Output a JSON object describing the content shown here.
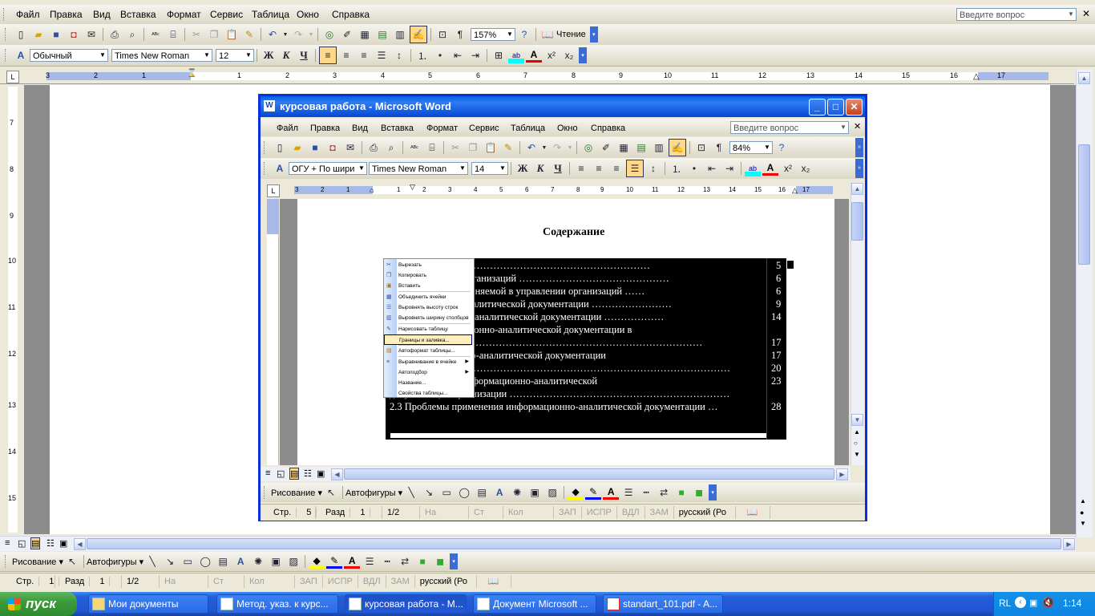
{
  "outer": {
    "menu": [
      "Файл",
      "Правка",
      "Вид",
      "Вставка",
      "Формат",
      "Сервис",
      "Таблица",
      "Окно",
      "Справка"
    ],
    "ask_placeholder": "Введите вопрос",
    "zoom": "157%",
    "read_label": "Чтение",
    "style": "Обычный",
    "font": "Times New Roman",
    "size": "12",
    "drawing_label": "Рисование",
    "autoshapes_label": "Автофигуры",
    "ruler_ticks": [
      "3",
      "2",
      "1",
      "1",
      "2",
      "3",
      "4",
      "5",
      "6",
      "7",
      "8",
      "9",
      "10",
      "11",
      "12",
      "13",
      "14",
      "15",
      "16",
      "17"
    ],
    "vruler_ticks": [
      "7",
      "8",
      "9",
      "10",
      "11",
      "12",
      "13",
      "14",
      "15"
    ],
    "status": {
      "page": "Стр.",
      "page_num": "1",
      "section": "Разд",
      "section_num": "1",
      "pages": "1/2",
      "at": "На",
      "line": "Ст",
      "col": "Кол",
      "rec": "ЗАП",
      "trk": "ИСПР",
      "ext": "ВДЛ",
      "ovr": "ЗАМ",
      "lang": "русский (Ро"
    }
  },
  "inner": {
    "title": "курсовая работа - Microsoft Word",
    "menu": [
      "Файл",
      "Правка",
      "Вид",
      "Вставка",
      "Формат",
      "Сервис",
      "Таблица",
      "Окно",
      "Справка"
    ],
    "ask_placeholder": "Введите вопрос",
    "zoom": "84%",
    "style": "ОГУ + По шири",
    "font": "Times New Roman",
    "size": "14",
    "drawing_label": "Рисование",
    "autoshapes_label": "Автофигуры",
    "ruler_ticks": [
      "3",
      "2",
      "1",
      "1",
      "2",
      "3",
      "4",
      "5",
      "6",
      "7",
      "8",
      "9",
      "10",
      "11",
      "12",
      "13",
      "14",
      "15",
      "16",
      "17"
    ],
    "status": {
      "page": "Стр.",
      "page_num": "5",
      "section": "Разд",
      "section_num": "1",
      "pages": "1/2",
      "at": "На",
      "line": "Ст",
      "col": "Кол",
      "rec": "ЗАП",
      "trk": "ИСПР",
      "ext": "ВДЛ",
      "ovr": "ЗАМ",
      "lang": "русский (Ро"
    }
  },
  "document": {
    "heading": "Содержание",
    "toc": [
      {
        "text": "……………………………………………………………………",
        "page": "5"
      },
      {
        "text": "ии в управлении организаций ………………………………………",
        "page": "6"
      },
      {
        "text": "информации, применяемой в управлении организаций ……",
        "page": "6"
      },
      {
        "text": "информационно-аналитической документации ……………………",
        "page": "9"
      },
      {
        "text": "ия информационно-аналитической документации ………………",
        "page": "14"
      },
      {
        "text": "зования   информационно-аналитической   документации   в",
        "page": ""
      },
      {
        "text": "изаций …………………………………………………………………………",
        "page": "17"
      },
      {
        "text": "ика       информационно-аналитической       документации",
        "page": "17"
      },
      {
        "text": "…………………………………………………………………………………………",
        "page": "20"
      },
      {
        "text": "сти       оформления       информационно-аналитической",
        "page": "23"
      },
      {
        "text": "документации организации …………………………………………………………",
        "page": ""
      },
      {
        "text": "2.3 Проблемы применения информационно-аналитической документации …",
        "page": "28"
      }
    ]
  },
  "context_menu": [
    {
      "label": "Вырезать",
      "icon": "scissors-icon"
    },
    {
      "label": "Копировать",
      "icon": "copy-icon"
    },
    {
      "label": "Вставить",
      "icon": "paste-icon"
    },
    {
      "label": "Объединить ячейки",
      "icon": "merge-cells-icon"
    },
    {
      "label": "Выровнять высоту строк",
      "icon": "row-height-icon"
    },
    {
      "label": "Выровнять ширину столбцов",
      "icon": "column-width-icon"
    },
    {
      "label": "Нарисовать таблицу",
      "icon": "draw-table-icon"
    },
    {
      "label": "Границы и заливка...",
      "icon": ""
    },
    {
      "label": "Автоформат таблицы...",
      "icon": "autoformat-icon"
    },
    {
      "label": "Выравнивание в ячейке",
      "icon": "cell-align-icon"
    },
    {
      "label": "Автоподбор",
      "icon": ""
    },
    {
      "label": "Название...",
      "icon": ""
    },
    {
      "label": "Свойства таблицы...",
      "icon": ""
    }
  ],
  "taskbar": {
    "start": "пуск",
    "tasks": [
      "Мои документы",
      "Метод. указ. к курс...",
      "курсовая работа - M...",
      "Документ Microsoft ...",
      "standart_101.pdf - A..."
    ],
    "lang": "RL",
    "clock": "1:14"
  }
}
